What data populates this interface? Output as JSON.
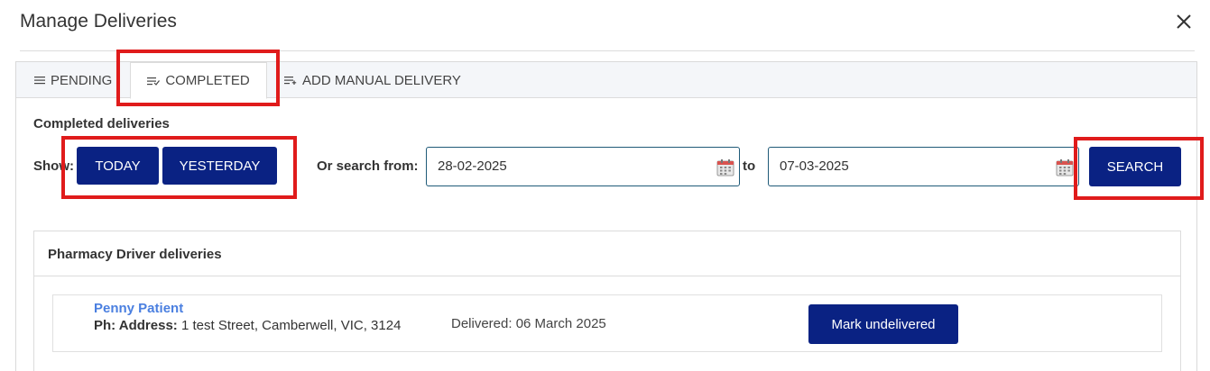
{
  "modal": {
    "title": "Manage Deliveries"
  },
  "tabs": [
    {
      "label": "PENDING",
      "icon": "list-icon"
    },
    {
      "label": "COMPLETED",
      "icon": "list-check-icon",
      "active": true
    },
    {
      "label": "ADD MANUAL DELIVERY",
      "icon": "list-add-icon"
    }
  ],
  "completed": {
    "section_title": "Completed deliveries",
    "show_label": "Show:",
    "today_label": "TODAY",
    "yesterday_label": "YESTERDAY",
    "search_from_label": "Or search from:",
    "from_date": "28-02-2025",
    "to_label": "to",
    "to_date": "07-03-2025",
    "search_label": "SEARCH"
  },
  "driver_deliveries": {
    "title": "Pharmacy Driver deliveries",
    "items": [
      {
        "patient_name": "Penny Patient",
        "address_label": "Ph: Address:",
        "address": "1 test Street, Camberwell, VIC, 3124",
        "delivered": "Delivered: 06 March 2025",
        "action_label": "Mark undelivered"
      }
    ]
  },
  "colors": {
    "primary_button": "#0a2283",
    "link": "#4a7fe0",
    "highlight": "#e01b1b",
    "input_border": "#1f5a78"
  }
}
